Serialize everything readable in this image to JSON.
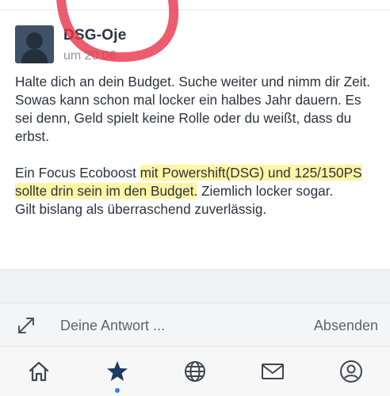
{
  "post": {
    "author": "DSG-Oje",
    "time": "um 20:06",
    "paragraph1": "Halte dich an dein Budget. Suche weiter und nimm dir Zeit. Sowas kann schon mal locker ein halbes Jahr dauern. Es sei denn, Geld spielt keine Rolle oder du weißt, dass du erbst.",
    "paragraph2_part1": "Ein Focus Ecoboost ",
    "paragraph2_highlight": "mit Powershift(DSG) und 125/150PS sollte drin sein im den Budget.",
    "paragraph2_part2": " Ziemlich locker sogar.",
    "paragraph2_line_last": "Gilt bislang als überraschend zuverlässig."
  },
  "reply": {
    "placeholder": "Deine Antwort ...",
    "send_label": "Absenden"
  },
  "tabbar": {
    "items": [
      {
        "icon": "home-icon"
      },
      {
        "icon": "star-icon",
        "active": true
      },
      {
        "icon": "globe-icon"
      },
      {
        "icon": "mail-icon"
      },
      {
        "icon": "profile-icon"
      }
    ]
  },
  "colors": {
    "accent": "#1d3a63",
    "active_dot": "#3b7ed8",
    "highlight": "#ffec5a",
    "annotation_red": "#e8334a"
  }
}
